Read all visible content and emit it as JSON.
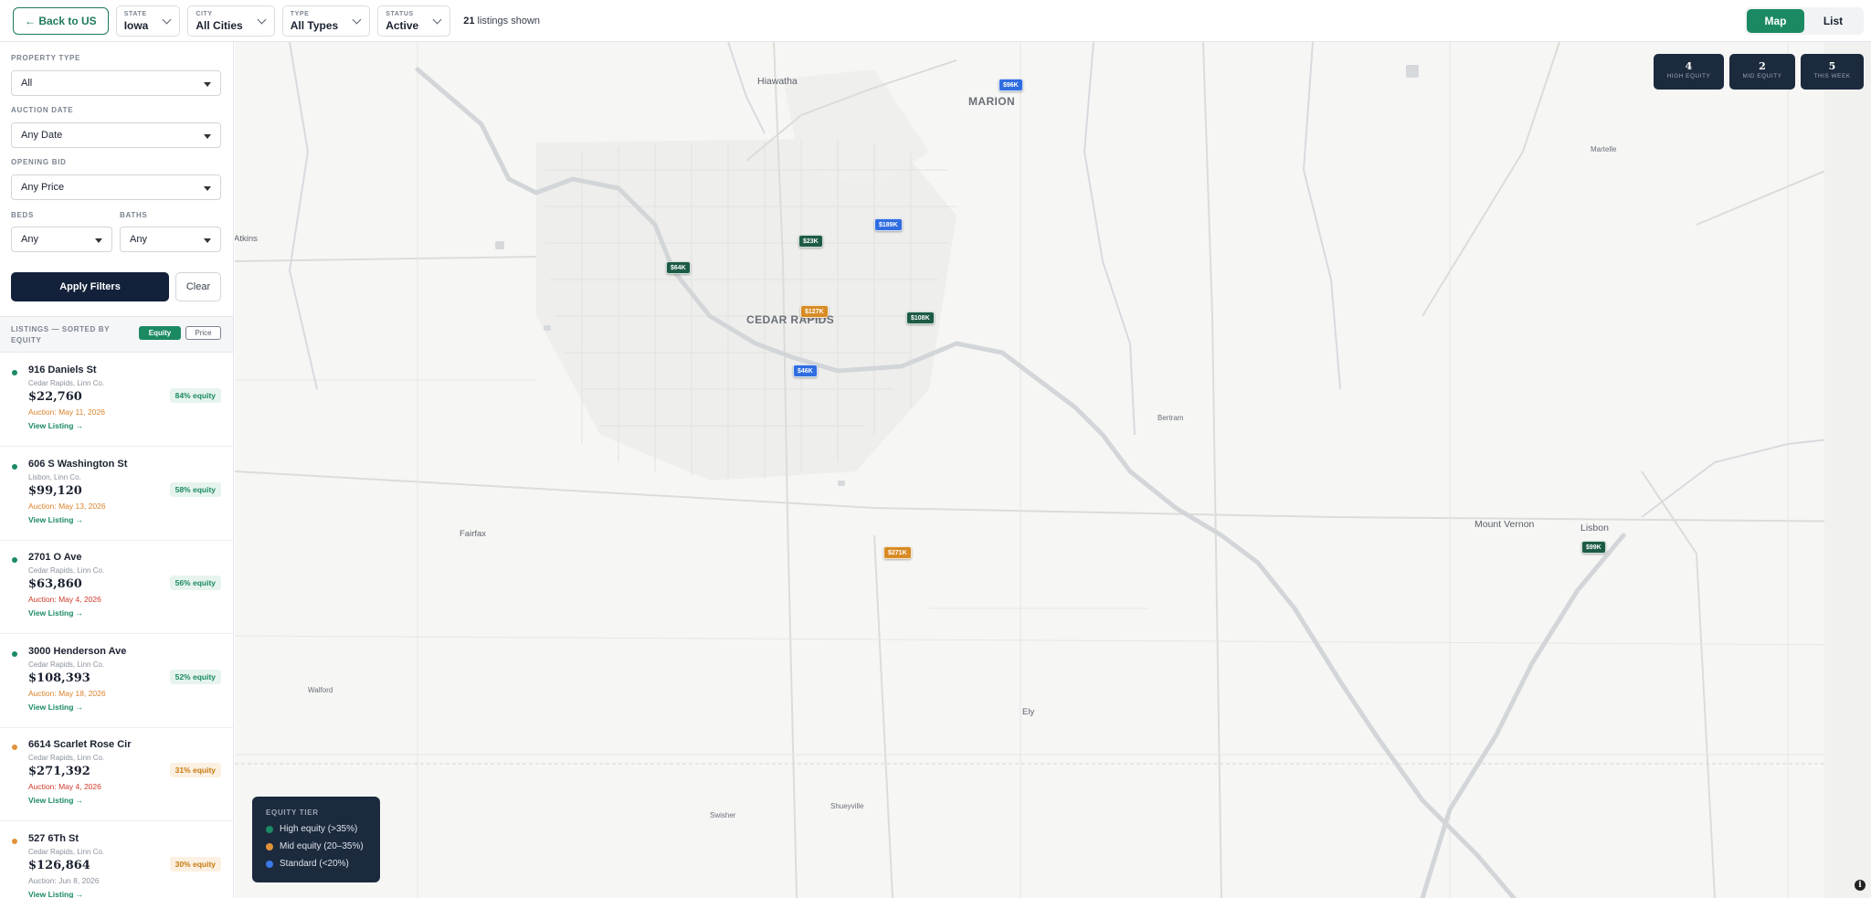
{
  "topbar": {
    "back_label": "← Back to US",
    "state": {
      "label": "STATE",
      "value": "Iowa"
    },
    "city": {
      "label": "CITY",
      "value": "All Cities"
    },
    "type": {
      "label": "TYPE",
      "value": "All Types"
    },
    "status": {
      "label": "STATUS",
      "value": "Active"
    },
    "count_number": "21",
    "count_text": " listings shown",
    "view_map": "Map",
    "view_list": "List"
  },
  "filters": {
    "property_type": {
      "label": "PROPERTY TYPE",
      "value": "All"
    },
    "auction_date": {
      "label": "AUCTION DATE",
      "value": "Any Date"
    },
    "opening_bid": {
      "label": "OPENING BID",
      "value": "Any Price"
    },
    "beds": {
      "label": "BEDS",
      "value": "Any"
    },
    "baths": {
      "label": "BATHS",
      "value": "Any"
    },
    "apply_label": "Apply Filters",
    "clear_label": "Clear"
  },
  "list_header": {
    "title": "LISTINGS — SORTED BY EQUITY",
    "sort_equity": "Equity",
    "sort_price": "Price"
  },
  "listings": [
    {
      "address": "916 Daniels St",
      "location": "Cedar Rapids, Linn Co.",
      "price": "$22,760",
      "auction": "Auction: May 11, 2026",
      "auction_color": "#d9822b",
      "view": "View Listing →",
      "equity": "84% equity",
      "tier": "high"
    },
    {
      "address": "606 S Washington St",
      "location": "Lisbon, Linn Co.",
      "price": "$99,120",
      "auction": "Auction: May 13, 2026",
      "auction_color": "#d9822b",
      "view": "View Listing →",
      "equity": "58% equity",
      "tier": "high"
    },
    {
      "address": "2701 O Ave",
      "location": "Cedar Rapids, Linn Co.",
      "price": "$63,860",
      "auction": "Auction: May 4, 2026",
      "auction_color": "#d0392b",
      "view": "View Listing →",
      "equity": "56% equity",
      "tier": "high"
    },
    {
      "address": "3000 Henderson Ave",
      "location": "Cedar Rapids, Linn Co.",
      "price": "$108,393",
      "auction": "Auction: May 18, 2026",
      "auction_color": "#d9822b",
      "view": "View Listing →",
      "equity": "52% equity",
      "tier": "high"
    },
    {
      "address": "6614 Scarlet Rose Cir",
      "location": "Cedar Rapids, Linn Co.",
      "price": "$271,392",
      "auction": "Auction: May 4, 2026",
      "auction_color": "#d0392b",
      "view": "View Listing →",
      "equity": "31% equity",
      "tier": "mid"
    },
    {
      "address": "527 6Th St",
      "location": "Cedar Rapids, Linn Co.",
      "price": "$126,864",
      "auction": "Auction: Jun 8, 2026",
      "auction_color": "#8a919c",
      "view": "View Listing →",
      "equity": "30% equity",
      "tier": "mid"
    }
  ],
  "colors": {
    "high": "#1b8a63",
    "mid": "#e0933a",
    "std": "#3b78e7"
  },
  "map": {
    "places": {
      "hiawatha": "Hiawatha",
      "marion": "MARION",
      "cedar_rapids": "CEDAR RAPIDS",
      "atkins": "Atkins",
      "fairfax": "Fairfax",
      "bertram": "Bertram",
      "martelle": "Martelle",
      "mount_vernon": "Mount Vernon",
      "lisbon": "Lisbon",
      "walford": "Walford",
      "ely": "Ely",
      "swisher": "Swisher",
      "shueyville": "Shueyville"
    },
    "pins": {
      "p96k": "$96K",
      "p189k": "$189K",
      "p23k": "$23K",
      "p64k": "$64K",
      "p127k": "$127K",
      "p108k": "$108K",
      "p46k": "$46K",
      "p271k": "$271K",
      "p99k": "$99K"
    },
    "stats": [
      {
        "number": "4",
        "label": "HIGH EQUITY"
      },
      {
        "number": "2",
        "label": "MID EQUITY"
      },
      {
        "number": "5",
        "label": "THIS WEEK"
      }
    ],
    "legend": {
      "title": "EQUITY TIER",
      "high": "High equity (>35%)",
      "mid": "Mid equity (20–35%)",
      "std": "Standard (<20%)"
    },
    "info": "i"
  }
}
